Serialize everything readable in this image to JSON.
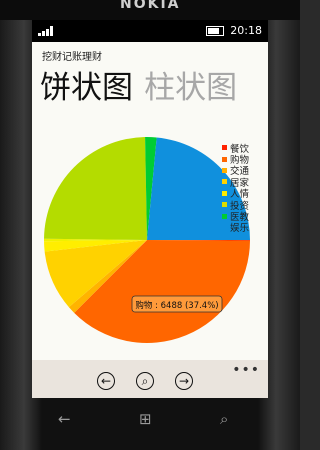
{
  "device": {
    "brand": "NOKIA"
  },
  "status": {
    "time": "20:18"
  },
  "app": {
    "title": "挖财记账理财"
  },
  "pivot": {
    "tabs": [
      {
        "label": "饼状图"
      },
      {
        "label": "柱状图"
      }
    ]
  },
  "chart_data": {
    "type": "pie",
    "title": "",
    "slices": [
      {
        "name": "餐饮",
        "value": 0.1
      },
      {
        "name": "购物",
        "value": 37.4,
        "color": "#ff6600"
      },
      {
        "name": "交通",
        "value": 1.2,
        "color": "#ffb400"
      },
      {
        "name": "居家",
        "value": 9.5,
        "color": "#ffd200"
      },
      {
        "name": "人情",
        "value": 1.6,
        "color": "#ffee00"
      },
      {
        "name": "投资",
        "value": 0.4,
        "color": "#f0f000"
      },
      {
        "name": "医教",
        "value": 24.5,
        "color": "#b4dc00"
      },
      {
        "name": "娱乐",
        "value": 1.8,
        "color": "#00cc33"
      },
      {
        "name": "",
        "value": 23.5,
        "color": "#1090dd"
      }
    ],
    "legend_colors": [
      "#ff2200",
      "#ff6600",
      "#ffb000",
      "#ffd200",
      "#ffee00",
      "#dddd00",
      "#00cc33",
      "#1090dd"
    ],
    "tooltip": "购物 : 6488 (37.4%)",
    "legend_position": "top-right"
  },
  "appbar": {
    "buttons": [
      {
        "icon": "←"
      },
      {
        "icon": "⌕"
      },
      {
        "icon": "→"
      }
    ],
    "more": "•••"
  },
  "hardware": {
    "back": "←",
    "start": "⊞",
    "search": "⌕"
  }
}
